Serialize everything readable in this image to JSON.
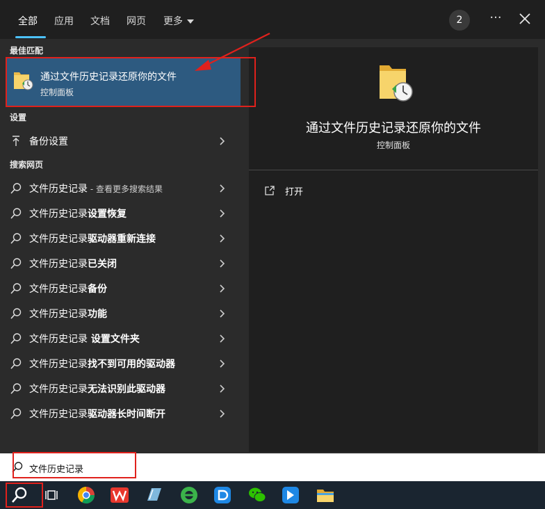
{
  "tabs": [
    {
      "label": "全部",
      "active": true
    },
    {
      "label": "应用"
    },
    {
      "label": "文档"
    },
    {
      "label": "网页"
    },
    {
      "label": "更多"
    }
  ],
  "header": {
    "badge_count": "2",
    "more_icon": "ellipsis-icon",
    "close_icon": "close-icon"
  },
  "sections": {
    "best_match": "最佳匹配",
    "settings": "设置",
    "web_search": "搜索网页"
  },
  "best_match": {
    "title": "通过文件历史记录还原你的文件",
    "subtitle": "控制面板",
    "icon": "file-history-folder-icon"
  },
  "settings_items": [
    {
      "label": "备份设置",
      "icon": "upload-arrow-icon"
    }
  ],
  "web_results": [
    {
      "prefix": "文件历史记录",
      "suffix": "",
      "extra": " - 查看更多搜索结果"
    },
    {
      "prefix": "文件历史记录",
      "suffix": "设置恢复",
      "extra": ""
    },
    {
      "prefix": "文件历史记录",
      "suffix": "驱动器重新连接",
      "extra": ""
    },
    {
      "prefix": "文件历史记录",
      "suffix": "已关闭",
      "extra": ""
    },
    {
      "prefix": "文件历史记录",
      "suffix": "备份",
      "extra": ""
    },
    {
      "prefix": "文件历史记录",
      "suffix": "功能",
      "extra": ""
    },
    {
      "prefix": "文件历史记录",
      "suffix": " 设置文件夹",
      "extra": ""
    },
    {
      "prefix": "文件历史记录",
      "suffix": "找不到可用的驱动器",
      "extra": ""
    },
    {
      "prefix": "文件历史记录",
      "suffix": "无法识别此驱动器",
      "extra": ""
    },
    {
      "prefix": "文件历史记录",
      "suffix": "驱动器长时间断开",
      "extra": ""
    }
  ],
  "preview": {
    "title": "通过文件历史记录还原你的文件",
    "subtitle": "控制面板",
    "open_label": "打开",
    "open_icon": "open-external-icon"
  },
  "search": {
    "value": "文件历史记录"
  },
  "taskbar": {
    "items": [
      "search-icon",
      "task-view-icon",
      "chrome-icon",
      "wps-icon",
      "notepad-icon",
      "ie-browser-icon",
      "d-app-icon",
      "wechat-icon",
      "feishu-icon",
      "file-explorer-icon"
    ]
  },
  "colors": {
    "accent": "#4cc2ff",
    "selection": "#2d5a80",
    "annotation": "#e0211c"
  }
}
